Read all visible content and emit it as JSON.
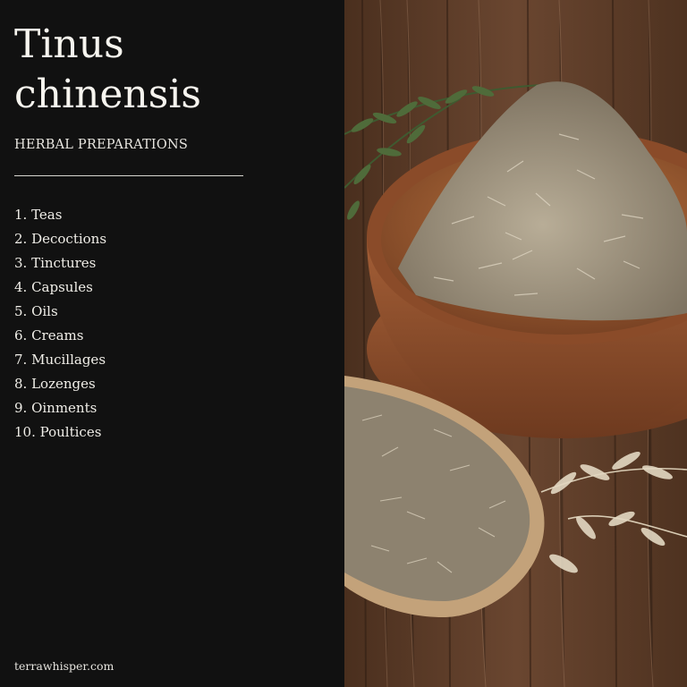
{
  "title": "Tinus chinensis",
  "subtitle": "HERBAL PREPARATIONS",
  "preparations": [
    "1. Teas",
    "2. Decoctions",
    "3. Tinctures",
    "4. Capsules",
    "5. Oils",
    "6. Creams",
    "7. Mucillages",
    "8. Lozenges",
    "9. Oinments",
    "10. Poultices"
  ],
  "footer": "terrawhisper.com",
  "colors": {
    "panel": "#111111",
    "text": "#f2f0ea",
    "wood": "#5a3a26",
    "bowl": "#9b5a35",
    "herb": "#a89c86"
  },
  "photo": {
    "alt": "Bowl and wooden spoon of dried herbs on a wooden table"
  }
}
